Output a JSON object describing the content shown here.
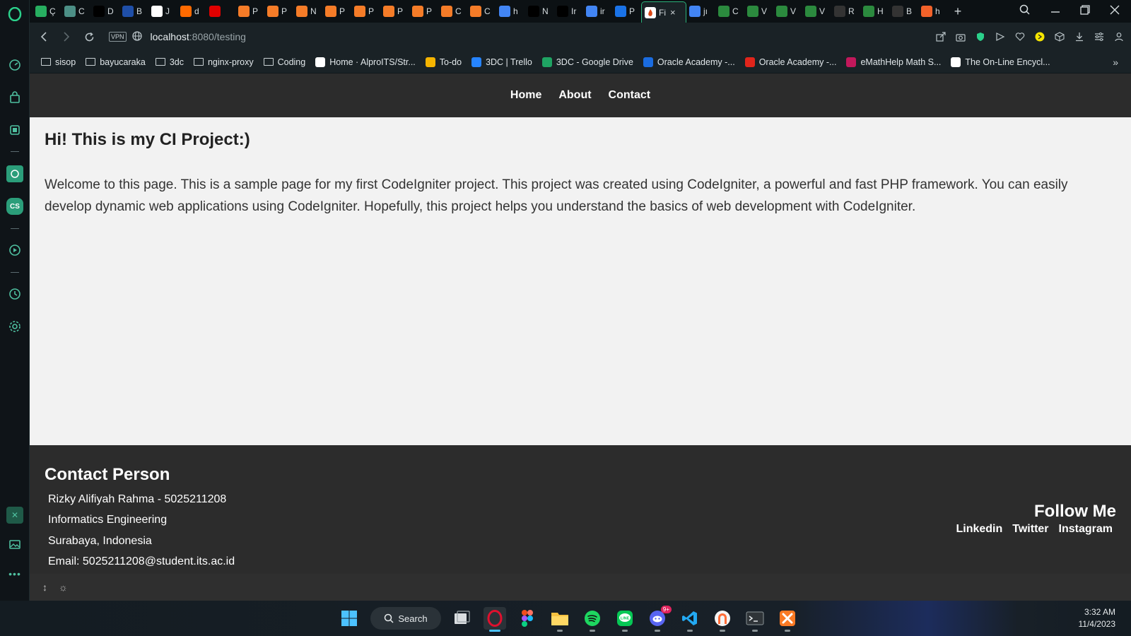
{
  "browser": {
    "tabs": [
      {
        "letter": "Ç",
        "color": "#27ae60"
      },
      {
        "letter": "C",
        "color": "#4c8f86"
      },
      {
        "letter": "D",
        "color": "#000000"
      },
      {
        "letter": "B",
        "color": "#1f4fa8"
      },
      {
        "letter": "J",
        "color": "#ffffff"
      },
      {
        "letter": "d",
        "color": "#ff6a00"
      },
      {
        "letter": "",
        "color": "#e10000"
      },
      {
        "letter": "P",
        "color": "#f57c28"
      },
      {
        "letter": "P",
        "color": "#f57c28"
      },
      {
        "letter": "N",
        "color": "#f57c28"
      },
      {
        "letter": "P",
        "color": "#f57c28"
      },
      {
        "letter": "P",
        "color": "#f57c28"
      },
      {
        "letter": "P",
        "color": "#f57c28"
      },
      {
        "letter": "P",
        "color": "#f57c28"
      },
      {
        "letter": "C",
        "color": "#f57c28"
      },
      {
        "letter": "C",
        "color": "#f57c28"
      },
      {
        "letter": "h",
        "color": "#4285f4"
      },
      {
        "letter": "N",
        "color": "#000000"
      },
      {
        "letter": "Ir",
        "color": "#000000"
      },
      {
        "letter": "ir",
        "color": "#4285f4"
      },
      {
        "letter": "P",
        "color": "#1a73e8"
      }
    ],
    "active_tab": {
      "letter": "Fi",
      "close": "×"
    },
    "tabs_after": [
      {
        "letter": "jı",
        "color": "#4285f4"
      },
      {
        "letter": "C",
        "color": "#2b8a3e"
      },
      {
        "letter": "V",
        "color": "#2b8a3e"
      },
      {
        "letter": "V",
        "color": "#2b8a3e"
      },
      {
        "letter": "V",
        "color": "#2b8a3e"
      },
      {
        "letter": "R",
        "color": "#333333"
      },
      {
        "letter": "H",
        "color": "#2b8a3e"
      },
      {
        "letter": "B",
        "color": "#333333"
      },
      {
        "letter": "h",
        "color": "#f2622a"
      }
    ],
    "new_tab": "+",
    "address": {
      "vpn": "VPN",
      "host": "localhost",
      "path": ":8080/testing"
    },
    "bookmarks": [
      {
        "label": "sisop",
        "type": "folder"
      },
      {
        "label": "bayucaraka",
        "type": "folder"
      },
      {
        "label": "3dc",
        "type": "folder"
      },
      {
        "label": "nginx-proxy",
        "type": "folder"
      },
      {
        "label": "Coding",
        "type": "folder"
      },
      {
        "label": "Home · AlproITS/Str...",
        "type": "github"
      },
      {
        "label": "To-do",
        "type": "todo"
      },
      {
        "label": "3DC | Trello",
        "type": "trello"
      },
      {
        "label": "3DC - Google Drive",
        "type": "drive"
      },
      {
        "label": "Oracle Academy -...",
        "type": "oracle-o"
      },
      {
        "label": "Oracle Academy -...",
        "type": "oracle"
      },
      {
        "label": "eMathHelp Math S...",
        "type": "emath"
      },
      {
        "label": "The On-Line Encycl...",
        "type": "oeis"
      }
    ]
  },
  "site": {
    "nav": [
      "Home",
      "About",
      "Contact"
    ],
    "heading": "Hi! This is my CI Project:)",
    "paragraph": "Welcome to this page. This is a sample page for my first CodeIgniter project. This project was created using CodeIgniter, a powerful and fast PHP framework. You can easily develop dynamic web applications using CodeIgniter. Hopefully, this project helps you understand the basics of web development with CodeIgniter.",
    "footer": {
      "contact_title": "Contact Person",
      "lines": [
        "Rizky Alifiyah Rahma - 5025211208",
        "Informatics Engineering",
        "Surabaya, Indonesia",
        "Email: 5025211208@student.its.ac.id"
      ],
      "follow_title": "Follow Me",
      "links": [
        "Linkedin",
        "Twitter",
        "Instagram"
      ]
    }
  },
  "taskbar": {
    "search_label": "Search",
    "discord_badge": "9+",
    "time": "3:32 AM",
    "date": "11/4/2023"
  }
}
